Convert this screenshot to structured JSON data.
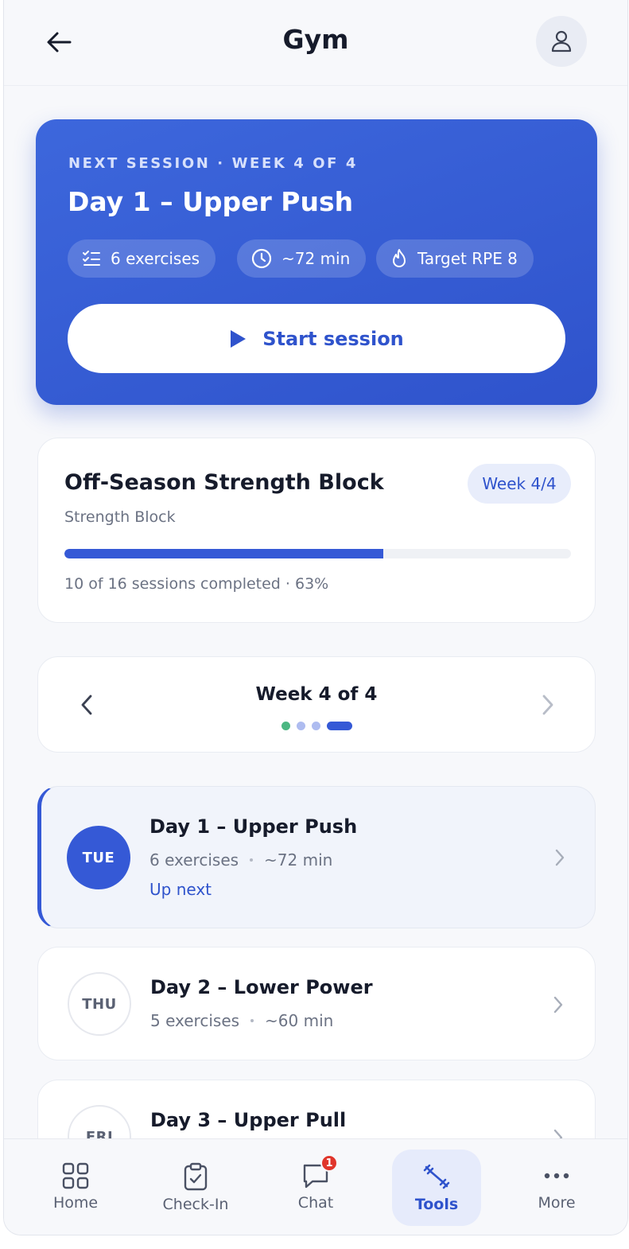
{
  "header": {
    "title": "Gym",
    "back_icon": "arrow-left-icon",
    "profile_icon": "user-icon"
  },
  "next_session": {
    "eyebrow": "NEXT SESSION · WEEK 4 OF 4",
    "title": "Day 1 – Upper Push",
    "exercises": "6 exercises",
    "duration": "~72 min",
    "target": "Target RPE 8",
    "start_label": "Start session",
    "accent_color": "#3559d6"
  },
  "program": {
    "title": "Off-Season Strength Block",
    "subtitle": "Strength Block",
    "week_badge": "Week 4/4",
    "progress_fraction": 0.63,
    "progress_text": "10 of 16 sessions completed · 63%"
  },
  "week_nav": {
    "title": "Week 4 of 4",
    "dots": [
      {
        "state": "completed",
        "color": "#4cb782"
      },
      {
        "state": "past",
        "color": "#aebcf0"
      },
      {
        "state": "past",
        "color": "#aebcf0"
      },
      {
        "state": "current",
        "color": "#3559d6"
      }
    ]
  },
  "days": [
    {
      "weekday": "TUE",
      "title": "Day 1 – Upper Push",
      "exercises": "6 exercises",
      "duration": "~72 min",
      "status": "Up next"
    },
    {
      "weekday": "THU",
      "title": "Day 2 – Lower Power",
      "exercises": "5 exercises",
      "duration": "~60 min",
      "status": ""
    },
    {
      "weekday": "FRI",
      "title": "Day 3 – Upper Pull",
      "exercises": "",
      "duration": "",
      "status": ""
    }
  ],
  "bottom_nav": {
    "items": [
      {
        "label": "Home",
        "icon": "grid-icon"
      },
      {
        "label": "Check-In",
        "icon": "clipboard-check-icon"
      },
      {
        "label": "Chat",
        "icon": "chat-bubble-icon",
        "badge": "1"
      },
      {
        "label": "Tools",
        "icon": "dumbbell-icon",
        "active": true
      },
      {
        "label": "More",
        "icon": "more-dots-icon"
      }
    ]
  }
}
